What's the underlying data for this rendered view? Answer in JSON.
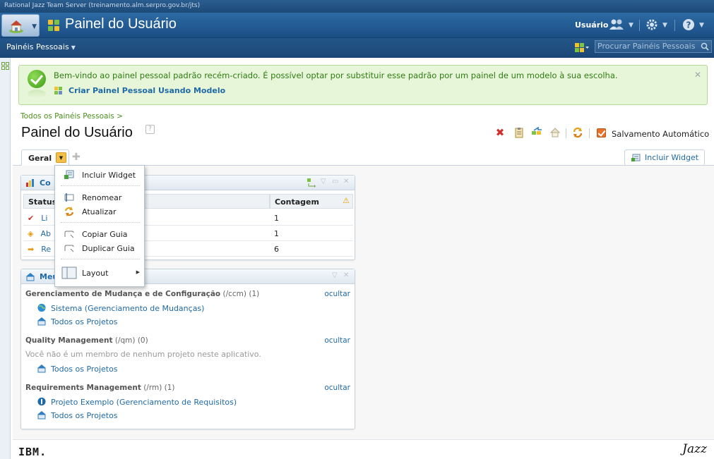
{
  "server_title": "Rational Jazz Team Server (treinamento.alm.serpro.gov.br/jts)",
  "app": {
    "title": "Painel do Usuário",
    "user_label": "Usuário",
    "icons": [
      "home-icon",
      "users-icon",
      "gear-icon",
      "help-icon"
    ]
  },
  "nav": {
    "menu_label": "Painéis Pessoais",
    "search_placeholder": "Procurar Painéis Pessoais"
  },
  "welcome": {
    "message": "Bem-vindo ao painel pessoal padrão recém-criado. É possível optar por substituir esse padrão por um painel de um modelo à sua escolha.",
    "link": "Criar Painel Pessoal Usando Modelo"
  },
  "breadcrumb": "Todos os Painéis Pessoais >",
  "page": {
    "title": "Painel do Usuário",
    "autosave_label": "Salvamento Automático",
    "autosave_checked": true
  },
  "tabs": [
    {
      "label": "Geral",
      "active": true
    }
  ],
  "incluir_widget": "Incluir Widget",
  "dropdown": {
    "items": [
      {
        "label": "Incluir Widget",
        "icon": "add-widget-icon"
      },
      {
        "label": "Renomear",
        "icon": "rename-icon"
      },
      {
        "label": "Atualizar",
        "icon": "refresh-icon"
      },
      {
        "label": "Copiar Guia",
        "icon": "copy-tab-icon"
      },
      {
        "label": "Duplicar Guia",
        "icon": "duplicate-tab-icon"
      },
      {
        "label": "Layout",
        "icon": "layout-icon",
        "submenu": true
      }
    ]
  },
  "widget1": {
    "title": "Co",
    "columns": [
      "Status",
      "Contagem"
    ],
    "rows": [
      {
        "status": "Li",
        "count": "1",
        "icon": "check-icon"
      },
      {
        "status": "Ab",
        "count": "1",
        "icon": "diamond-icon"
      },
      {
        "status": "Re",
        "count": "6",
        "icon": "arrow-icon"
      }
    ]
  },
  "widget2": {
    "title": "Meu",
    "sections": [
      {
        "name": "Gerenciamento de Mudança e de Configuração",
        "path": "(/ccm)",
        "count": "(1)",
        "hide": "ocultar",
        "note": "",
        "items": [
          "Sistema (Gerenciamento de Mudanças)",
          "Todos os Projetos"
        ]
      },
      {
        "name": "Quality Management",
        "path": "(/qm)",
        "count": "(0)",
        "hide": "ocultar",
        "note": "Você não é um membro de nenhum projeto neste aplicativo.",
        "items": [
          "Todos os Projetos"
        ]
      },
      {
        "name": "Requirements Management",
        "path": "(/rm)",
        "count": "(1)",
        "hide": "ocultar",
        "note": "",
        "items": [
          "Projeto Exemplo (Gerenciamento de Requisitos)",
          "Todos os Projetos"
        ]
      }
    ]
  },
  "footer": {
    "left": "IBM.",
    "right": "Jazz"
  }
}
